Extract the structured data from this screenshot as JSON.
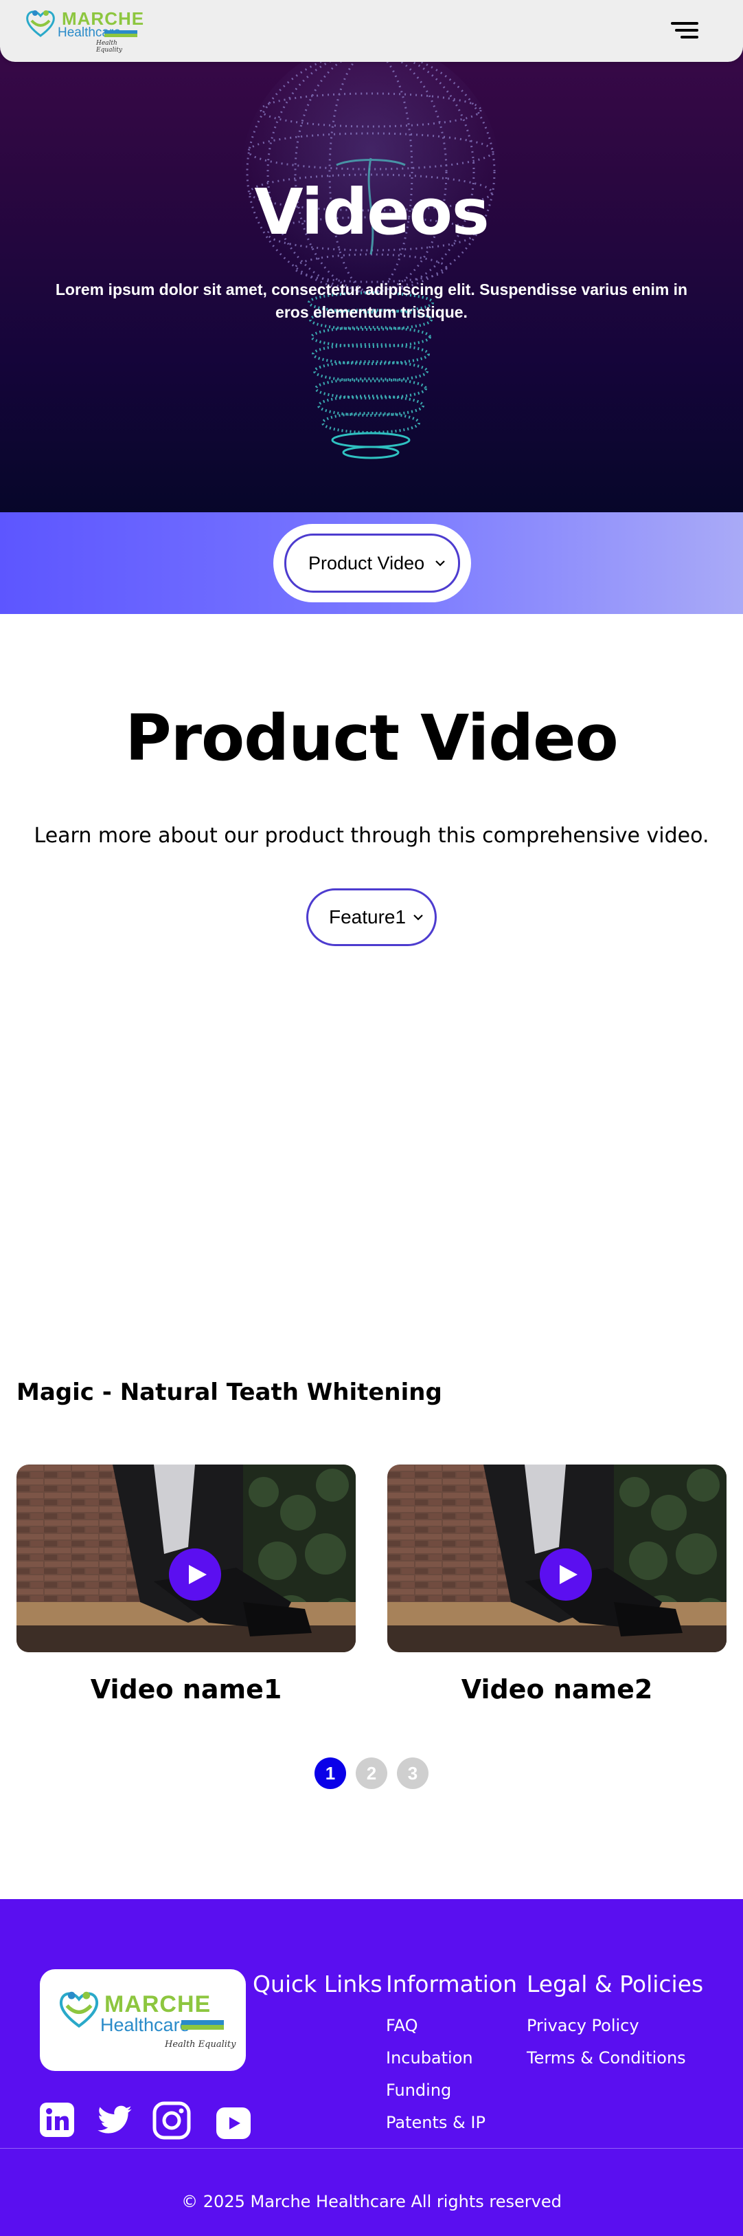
{
  "header": {
    "logo": {
      "brand": "MARCHE",
      "sub": "Healthcare",
      "tagline": "Health Equality"
    },
    "menu_icon": "hamburger-menu-icon"
  },
  "hero": {
    "title": "Videos",
    "subtitle": "Lorem ipsum dolor sit amet, consectetur adipiscing elit. Suspendisse varius enim in eros elementum tristique."
  },
  "category_select": {
    "value": "Product Video"
  },
  "main": {
    "title": "Product Video",
    "subtitle": "Learn more about our product through this comprehensive video.",
    "feature_select": {
      "value": "Feature1"
    },
    "section_title": "Magic - Natural Teath Whitening",
    "videos": [
      {
        "name": "Video name1"
      },
      {
        "name": "Video name2"
      }
    ],
    "pagination": [
      "1",
      "2",
      "3"
    ],
    "active_page": "1"
  },
  "footer": {
    "columns": {
      "quick_links": {
        "heading": "Quick Links"
      },
      "information": {
        "heading": "Information",
        "links": [
          "FAQ",
          "Incubation",
          "Funding",
          "Patents & IP"
        ]
      },
      "legal": {
        "heading": "Legal & Policies",
        "links": [
          "Privacy Policy",
          "Terms & Conditions"
        ]
      }
    },
    "social_icons": [
      "linkedin-icon",
      "twitter-icon",
      "instagram-icon",
      "youtube-icon"
    ],
    "copyright": "© 2025 Marche Healthcare All rights reserved"
  },
  "colors": {
    "accent": "#5a0ff0",
    "pagination_active": "#0a00e8",
    "select_border": "#4d3ccf",
    "brand_green": "#8dc63f",
    "brand_blue": "#2a8bc9"
  }
}
